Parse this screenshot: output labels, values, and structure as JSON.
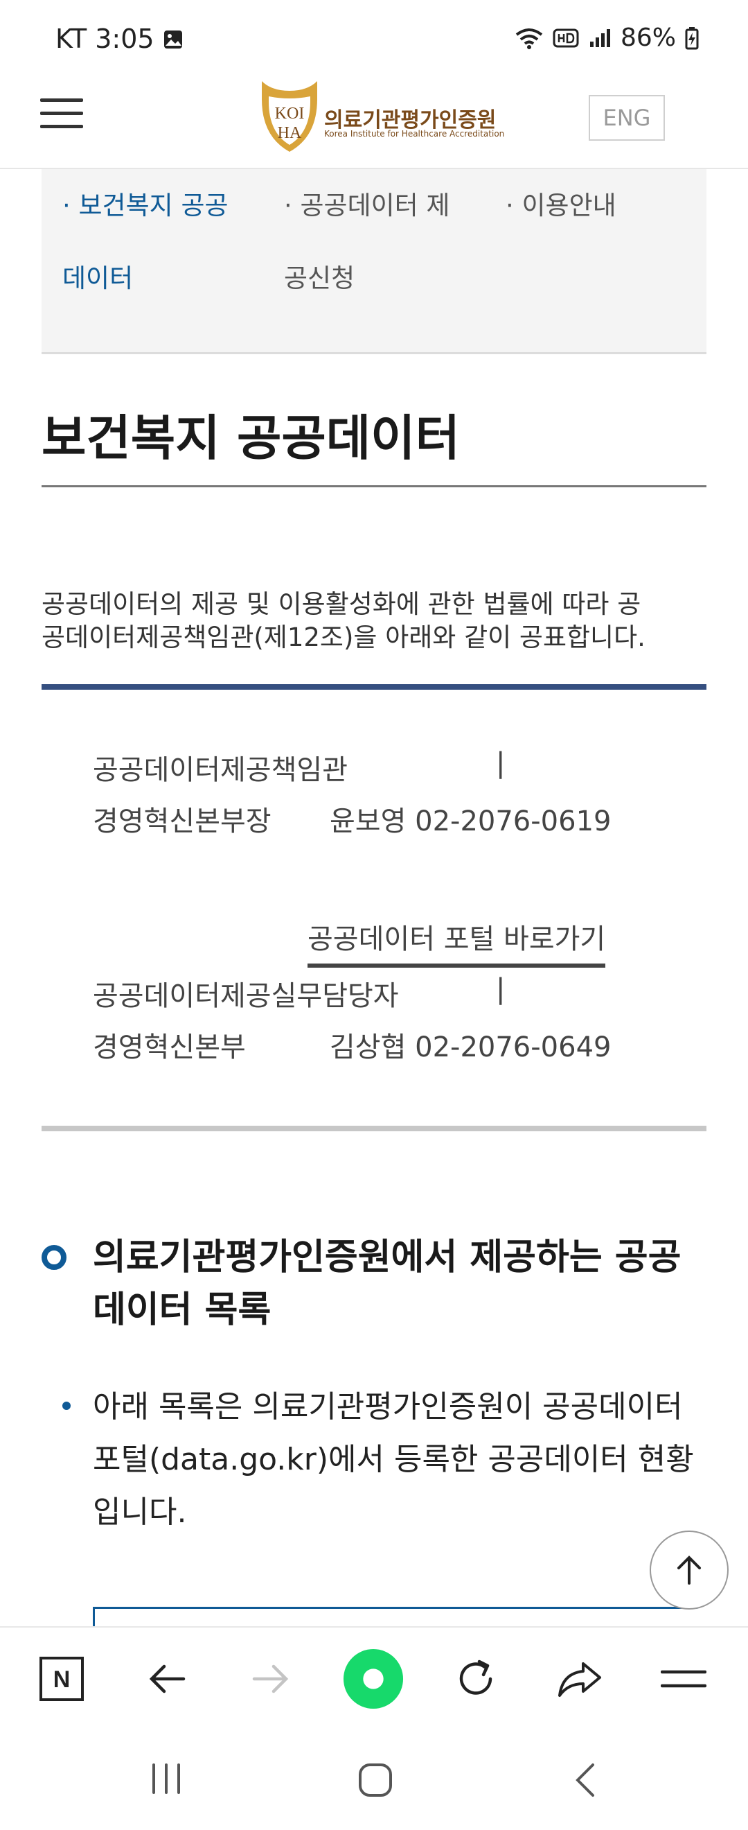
{
  "status": {
    "carrier_time": "KT 3:05",
    "battery": "86%"
  },
  "header": {
    "logo_abbr_top": "KOI",
    "logo_abbr_bottom": "HA",
    "logo_korean": "의료기관평가인증원",
    "logo_english": "Korea Institute for Healthcare Accreditation",
    "eng_button": "ENG"
  },
  "subnav": {
    "item1_line1": "· 보건복지 공공",
    "item1_line2": "데이터",
    "item2_line1": "· 공공데이터 제",
    "item2_line2": "공신청",
    "item3": "· 이용안내"
  },
  "page": {
    "title": "보건복지 공공데이터",
    "intro_line1": "공공데이터의 제공 및 이용활성화에 관한 법률에 따라 공",
    "intro_line2": "공데이터제공책임관(제12조)을 아래와 같이 공표합니다."
  },
  "info": {
    "officer_label": "공공데이터제공책임관",
    "sep": "|",
    "officer_dept": "경영혁신본부장",
    "officer_name_phone": "윤보영 02-2076-0619",
    "portal_link": "공공데이터 포털 바로가기",
    "staff_label": "공공데이터제공실무담당자",
    "staff_dept": "경영혁신본부",
    "staff_name_phone": "김상협 02-2076-0649"
  },
  "section": {
    "title_line1": "의료기관평가인증원에서 제공하는 공공",
    "title_line2": "데이터 목록",
    "para_line1": "아래 목록은 의료기관평가인증원이 공공데이터",
    "para_line2": "포털(data.go.kr)에서 등록한 공공데이터 현황",
    "para_line3": "입니다."
  },
  "toolbar": {
    "n_label": "N"
  },
  "colors": {
    "accent_blue": "#0f5a96",
    "navy_rule": "#354f80",
    "green": "#17d96b"
  }
}
